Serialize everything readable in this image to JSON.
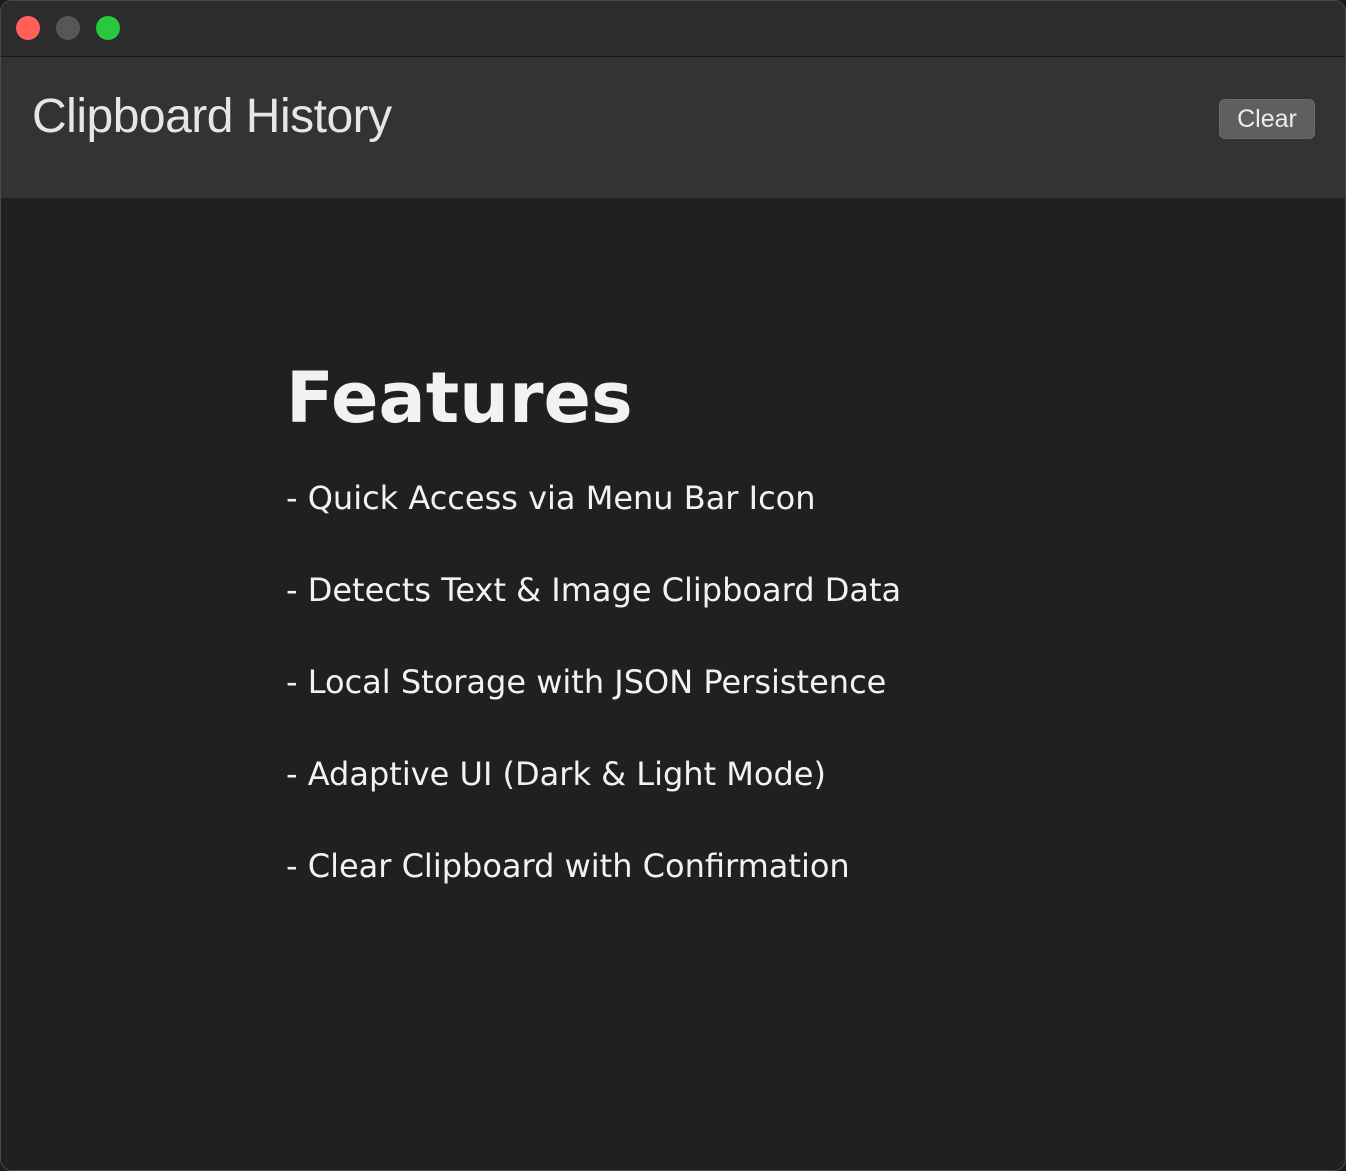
{
  "window": {
    "controls": [
      "close-icon",
      "minimize-icon",
      "zoom-icon"
    ]
  },
  "header": {
    "title": "Clipboard History",
    "clear_label": "Clear"
  },
  "content": {
    "title": "Features",
    "items": [
      "- Quick Access via Menu Bar Icon",
      "- Detects Text & Image Clipboard Data",
      "- Local Storage with JSON Persistence",
      "- Adaptive UI (Dark & Light Mode)",
      "- Clear Clipboard with Confirmation"
    ]
  },
  "colors": {
    "close": "#ff5f57",
    "minimize": "#575757",
    "zoom": "#28c840",
    "header_bg": "#333333",
    "content_bg": "#1f2020"
  }
}
